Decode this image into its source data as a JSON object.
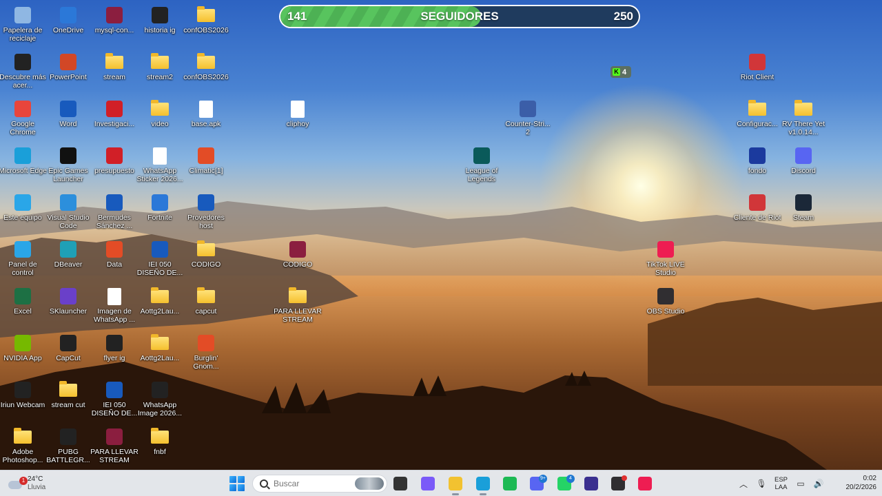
{
  "follower_goal": {
    "current": "141",
    "label": "SEGUIDORES",
    "goal": "250",
    "progress_fraction": 0.56,
    "fill_color": "#58c45e"
  },
  "kick_badge": {
    "count": "4",
    "brand_color": "#53fc18"
  },
  "desktop_icons": {
    "c1": [
      "Papelera de reciclaje",
      "Descubre más acer...",
      "Google Chrome",
      "Microsoft Edge",
      "Este equipo",
      "Panel de control",
      "Excel",
      "NVIDIA App",
      "Iriun Webcam",
      "Adobe Photoshop..."
    ],
    "c2": [
      "OneDrive",
      "PowerPoint",
      "Word",
      "Epic Games Launcher",
      "Visual Studio Code",
      "DBeaver",
      "SKlauncher",
      "CapCut",
      "stream cut",
      "PUBG BATTLEGR..."
    ],
    "c3": [
      "mysql-con...",
      "stream",
      "Investigaci...",
      "presupuesto",
      "Bermudes Sánchez ...",
      "Data",
      "Imagen de WhatsApp ...",
      "flyer ig",
      "IEI 050 DISEÑO DE...",
      "PARA LLEVAR STREAM"
    ],
    "c4": [
      "historia ig",
      "stream2",
      "video",
      "WhatsApp Sticker 2026...",
      "Fortnite",
      "IEI 050 DISEÑO DE...",
      "Aottg2Lau...",
      "Aottg2Lau...",
      "WhatsApp Image 2026...",
      "fnbf"
    ],
    "c5": [
      "confOBS2026",
      "confOBS2026",
      "base.apk",
      "Climatic[1]",
      "Provedores host",
      "CODIGO",
      "capcut",
      "Burglin' Gnom..."
    ],
    "misc": {
      "cliphoy": "cliphoy",
      "codigo_rar": "CODIGO",
      "para_llevar": "PARA LLEVAR STREAM",
      "cs2": "Counter-Stri... 2",
      "lol": "League of Legends",
      "riot_client": "Riot Client",
      "configurac": "Configurac...",
      "rv_there": "RV There Yet v1.0.14...",
      "fondo": "fondo",
      "discord": "Discord",
      "cliente_riot": "Cliente de Riot",
      "steam": "Steam",
      "tiktok_live": "TikTok LIVE Studio",
      "obs": "OBS Studio"
    }
  },
  "taskbar": {
    "weather": {
      "temp": "24°C",
      "condition": "Lluvia",
      "badge": "1"
    },
    "search_placeholder": "Buscar",
    "apps": [
      {
        "name": "task-view",
        "badge": ""
      },
      {
        "name": "copilot",
        "badge": ""
      },
      {
        "name": "file-explorer",
        "badge": ""
      },
      {
        "name": "edge",
        "badge": ""
      },
      {
        "name": "spotify",
        "badge": ""
      },
      {
        "name": "discord",
        "badge": "9+"
      },
      {
        "name": "whatsapp",
        "badge": "4"
      },
      {
        "name": "streaming-app",
        "badge": ""
      },
      {
        "name": "obs",
        "badge": ""
      },
      {
        "name": "tiktok-live",
        "badge": ""
      }
    ],
    "language": {
      "code": "ESP",
      "layout": "LAA"
    },
    "clock": {
      "time": "0:02",
      "date": "20/2/2026"
    }
  }
}
